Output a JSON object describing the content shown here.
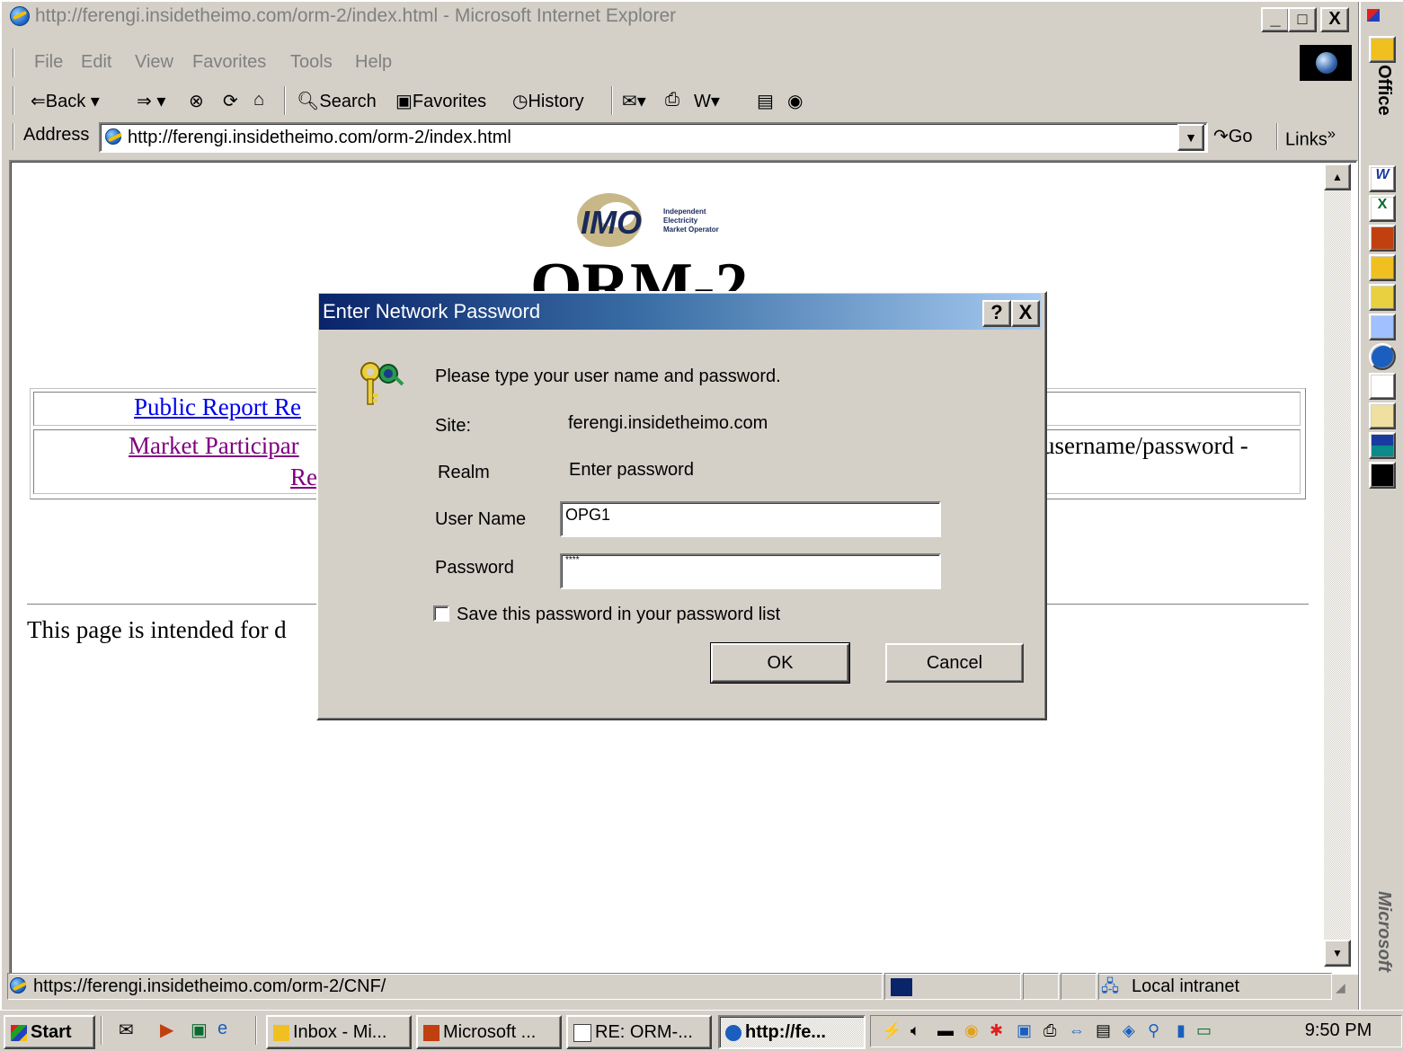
{
  "window": {
    "title": "http://ferengi.insidetheimo.com/orm-2/index.html - Microsoft Internet Explorer",
    "minimize": "_",
    "maximize": "□",
    "close": "X"
  },
  "menubar": {
    "items": [
      "File",
      "Edit",
      "View",
      "Favorites",
      "Tools",
      "Help"
    ]
  },
  "toolbar": {
    "back_label": "Back",
    "search_label": "Search",
    "favorites_label": "Favorites",
    "history_label": "History"
  },
  "addressbar": {
    "label": "Address",
    "url": "http://ferengi.insidetheimo.com/orm-2/index.html",
    "go_label": "Go",
    "links_label": "Links",
    "links_chevron": "»"
  },
  "page": {
    "logo_letters": "IMO",
    "logo_subtitle": [
      "Independent",
      "Electricity",
      "Market Operator"
    ],
    "title": "ORM-2",
    "public_report_link": "Public Report Re",
    "market_participant_link": "Market Participar",
    "market_participant_link_2": "Re",
    "username_password_text": "username/password -",
    "footer_text": "This page is intended for d"
  },
  "dialog": {
    "title": "Enter Network Password",
    "help_button": "?",
    "close_button": "X",
    "prompt": "Please type your user name and password.",
    "site_label": "Site:",
    "site_value": "ferengi.insidetheimo.com",
    "realm_label": "Realm",
    "realm_value": "Enter password",
    "username_label": "User Name",
    "username_value": "OPG1",
    "password_label": "Password",
    "password_value": "****",
    "save_password_label": "Save this password in your password list",
    "save_password_checked": false,
    "ok_label": "OK",
    "cancel_label": "Cancel"
  },
  "statusbar": {
    "status_text": "https://ferengi.insidetheimo.com/orm-2/CNF/",
    "zone_text": "Local intranet"
  },
  "taskbar": {
    "start_label": "Start",
    "tasks": [
      {
        "label": "Inbox - Mi...",
        "icon": "outlook-icon"
      },
      {
        "label": "Microsoft ...",
        "icon": "powerpoint-icon"
      },
      {
        "label": "RE: ORM-...",
        "icon": "mail-icon"
      },
      {
        "label": "http://fe...",
        "icon": "ie-icon",
        "active": true
      }
    ],
    "clock": "9:50 PM"
  },
  "officebar": {
    "label": "Office",
    "brand": "Microsoft"
  },
  "colors": {
    "dialog_title_start": "#0a246a",
    "dialog_title_end": "#a6caf0",
    "link_blue": "#0000ee",
    "link_visited": "#800080",
    "face": "#d4d0c8",
    "logo_tan": "#c8b888",
    "logo_navy": "#1a2a5a"
  }
}
